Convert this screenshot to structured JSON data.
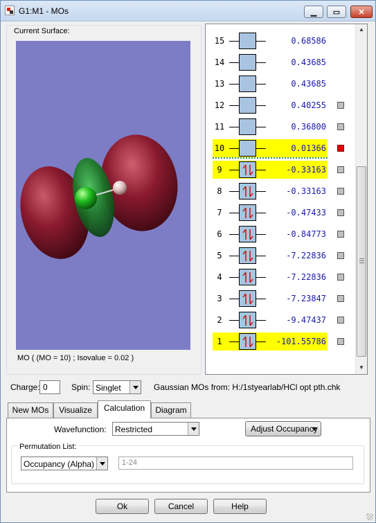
{
  "window": {
    "title": "G1:M1 - MOs",
    "minimize_glyph": "▁",
    "maximize_glyph": "▭",
    "close_glyph": "✕"
  },
  "surface": {
    "group_label": "Current Surface:",
    "caption": "MO ( (MO = 10) ; Isovalue = 0.02 )",
    "background_color": "#7d7dc6",
    "lobe_colors": {
      "red": "#8a1a2e",
      "green": "#1f7a2a"
    }
  },
  "orbitals": [
    {
      "num": "15",
      "energy": "0.68586",
      "occupied": false,
      "highlighted": false,
      "selector": "none"
    },
    {
      "num": "14",
      "energy": "0.43685",
      "occupied": false,
      "highlighted": false,
      "selector": "none"
    },
    {
      "num": "13",
      "energy": "0.43685",
      "occupied": false,
      "highlighted": false,
      "selector": "none"
    },
    {
      "num": "12",
      "energy": "0.40255",
      "occupied": false,
      "highlighted": false,
      "selector": "gray"
    },
    {
      "num": "11",
      "energy": "0.36800",
      "occupied": false,
      "highlighted": false,
      "selector": "gray"
    },
    {
      "num": "10",
      "energy": "0.01366",
      "occupied": false,
      "highlighted": true,
      "selector": "red"
    },
    {
      "num": "9",
      "energy": "-0.33163",
      "occupied": true,
      "highlighted": true,
      "selector": "gray"
    },
    {
      "num": "8",
      "energy": "-0.33163",
      "occupied": true,
      "highlighted": false,
      "selector": "gray"
    },
    {
      "num": "7",
      "energy": "-0.47433",
      "occupied": true,
      "highlighted": false,
      "selector": "gray"
    },
    {
      "num": "6",
      "energy": "-0.84773",
      "occupied": true,
      "highlighted": false,
      "selector": "gray"
    },
    {
      "num": "5",
      "energy": "-7.22836",
      "occupied": true,
      "highlighted": false,
      "selector": "gray"
    },
    {
      "num": "4",
      "energy": "-7.22836",
      "occupied": true,
      "highlighted": false,
      "selector": "gray"
    },
    {
      "num": "3",
      "energy": "-7.23847",
      "occupied": true,
      "highlighted": false,
      "selector": "gray"
    },
    {
      "num": "2",
      "energy": "-9.47437",
      "occupied": true,
      "highlighted": false,
      "selector": "gray"
    },
    {
      "num": "1",
      "energy": "-101.55786",
      "occupied": true,
      "highlighted": true,
      "selector": "gray"
    }
  ],
  "controls": {
    "charge_label": "Charge:",
    "charge_value": "0",
    "spin_label": "Spin:",
    "spin_value": "Singlet",
    "gaussian_label": "Gaussian MOs from:  H:/1styearlab/HCl opt pth.chk"
  },
  "tabs": [
    {
      "label": "New MOs",
      "active": false
    },
    {
      "label": "Visualize",
      "active": false
    },
    {
      "label": "Calculation",
      "active": true
    },
    {
      "label": "Diagram",
      "active": false
    }
  ],
  "calculation": {
    "wavefunction_label": "Wavefunction:",
    "wavefunction_value": "Restricted",
    "adjust_occupancy_label": "Adjust Occupancy",
    "permutation_label": "Permutation List:",
    "occupancy_value": "Occupancy (Alpha)",
    "range_placeholder": "1-24"
  },
  "footer": {
    "ok_label": "Ok",
    "cancel_label": "Cancel",
    "help_label": "Help"
  },
  "colors": {
    "highlight": "#ffff00",
    "energy_text": "#1a1aa8",
    "orbital_box": "#a8c4e0",
    "selected_marker": "#e00000",
    "electron_arrow": "#d00000"
  }
}
